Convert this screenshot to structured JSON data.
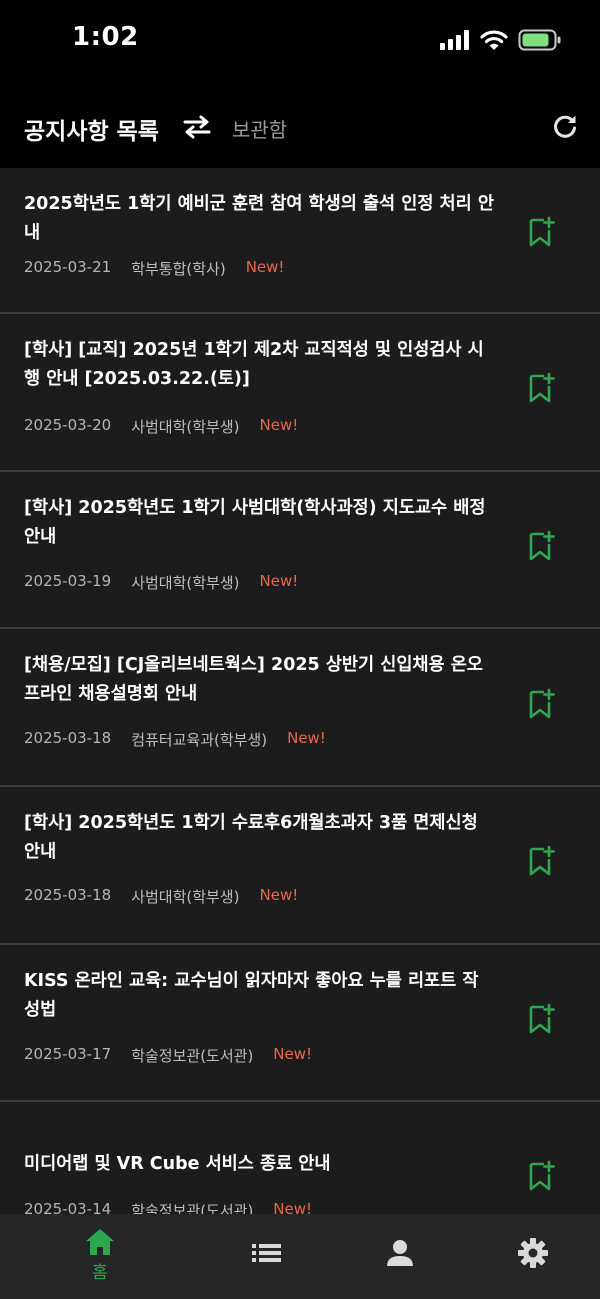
{
  "status_bar": {
    "time": "1:02"
  },
  "header": {
    "title": "공지사항 목록",
    "archive_label": "보관함"
  },
  "notices": [
    {
      "title": "2025학년도 1학기 예비군 훈련 참여 학생의 출석 인정 처리 안내",
      "date": "2025-03-21",
      "department": "학부통합(학사)",
      "badge": "New!"
    },
    {
      "title": "[학사] [교직] 2025년 1학기 제2차 교직적성 및 인성검사 시행 안내 [2025.03.22.(토)]",
      "date": "2025-03-20",
      "department": "사범대학(학부생)",
      "badge": "New!"
    },
    {
      "title": "[학사] 2025학년도 1학기 사범대학(학사과정) 지도교수 배정 안내",
      "date": "2025-03-19",
      "department": "사범대학(학부생)",
      "badge": "New!"
    },
    {
      "title": "[채용/모집] [CJ올리브네트웍스] 2025 상반기 신입채용 온오프라인 채용설명회 안내",
      "date": "2025-03-18",
      "department": "컴퓨터교육과(학부생)",
      "badge": "New!"
    },
    {
      "title": "[학사] 2025학년도 1학기 수료후6개월초과자 3품 면제신청 안내",
      "date": "2025-03-18",
      "department": "사범대학(학부생)",
      "badge": "New!"
    },
    {
      "title": "KISS 온라인 교육: 교수님이 읽자마자 좋아요 누를 리포트 작성법",
      "date": "2025-03-17",
      "department": "학술정보관(도서관)",
      "badge": "New!"
    },
    {
      "title": "미디어랩 및 VR Cube 서비스 종료 안내",
      "date": "2025-03-14",
      "department": "학술정보관(도서관)",
      "badge": "New!"
    }
  ],
  "tabbar": {
    "home_label": "홈"
  },
  "colors": {
    "accent": "#2ea84f",
    "new_badge": "#e8664b",
    "background": "#1c1c1c"
  }
}
